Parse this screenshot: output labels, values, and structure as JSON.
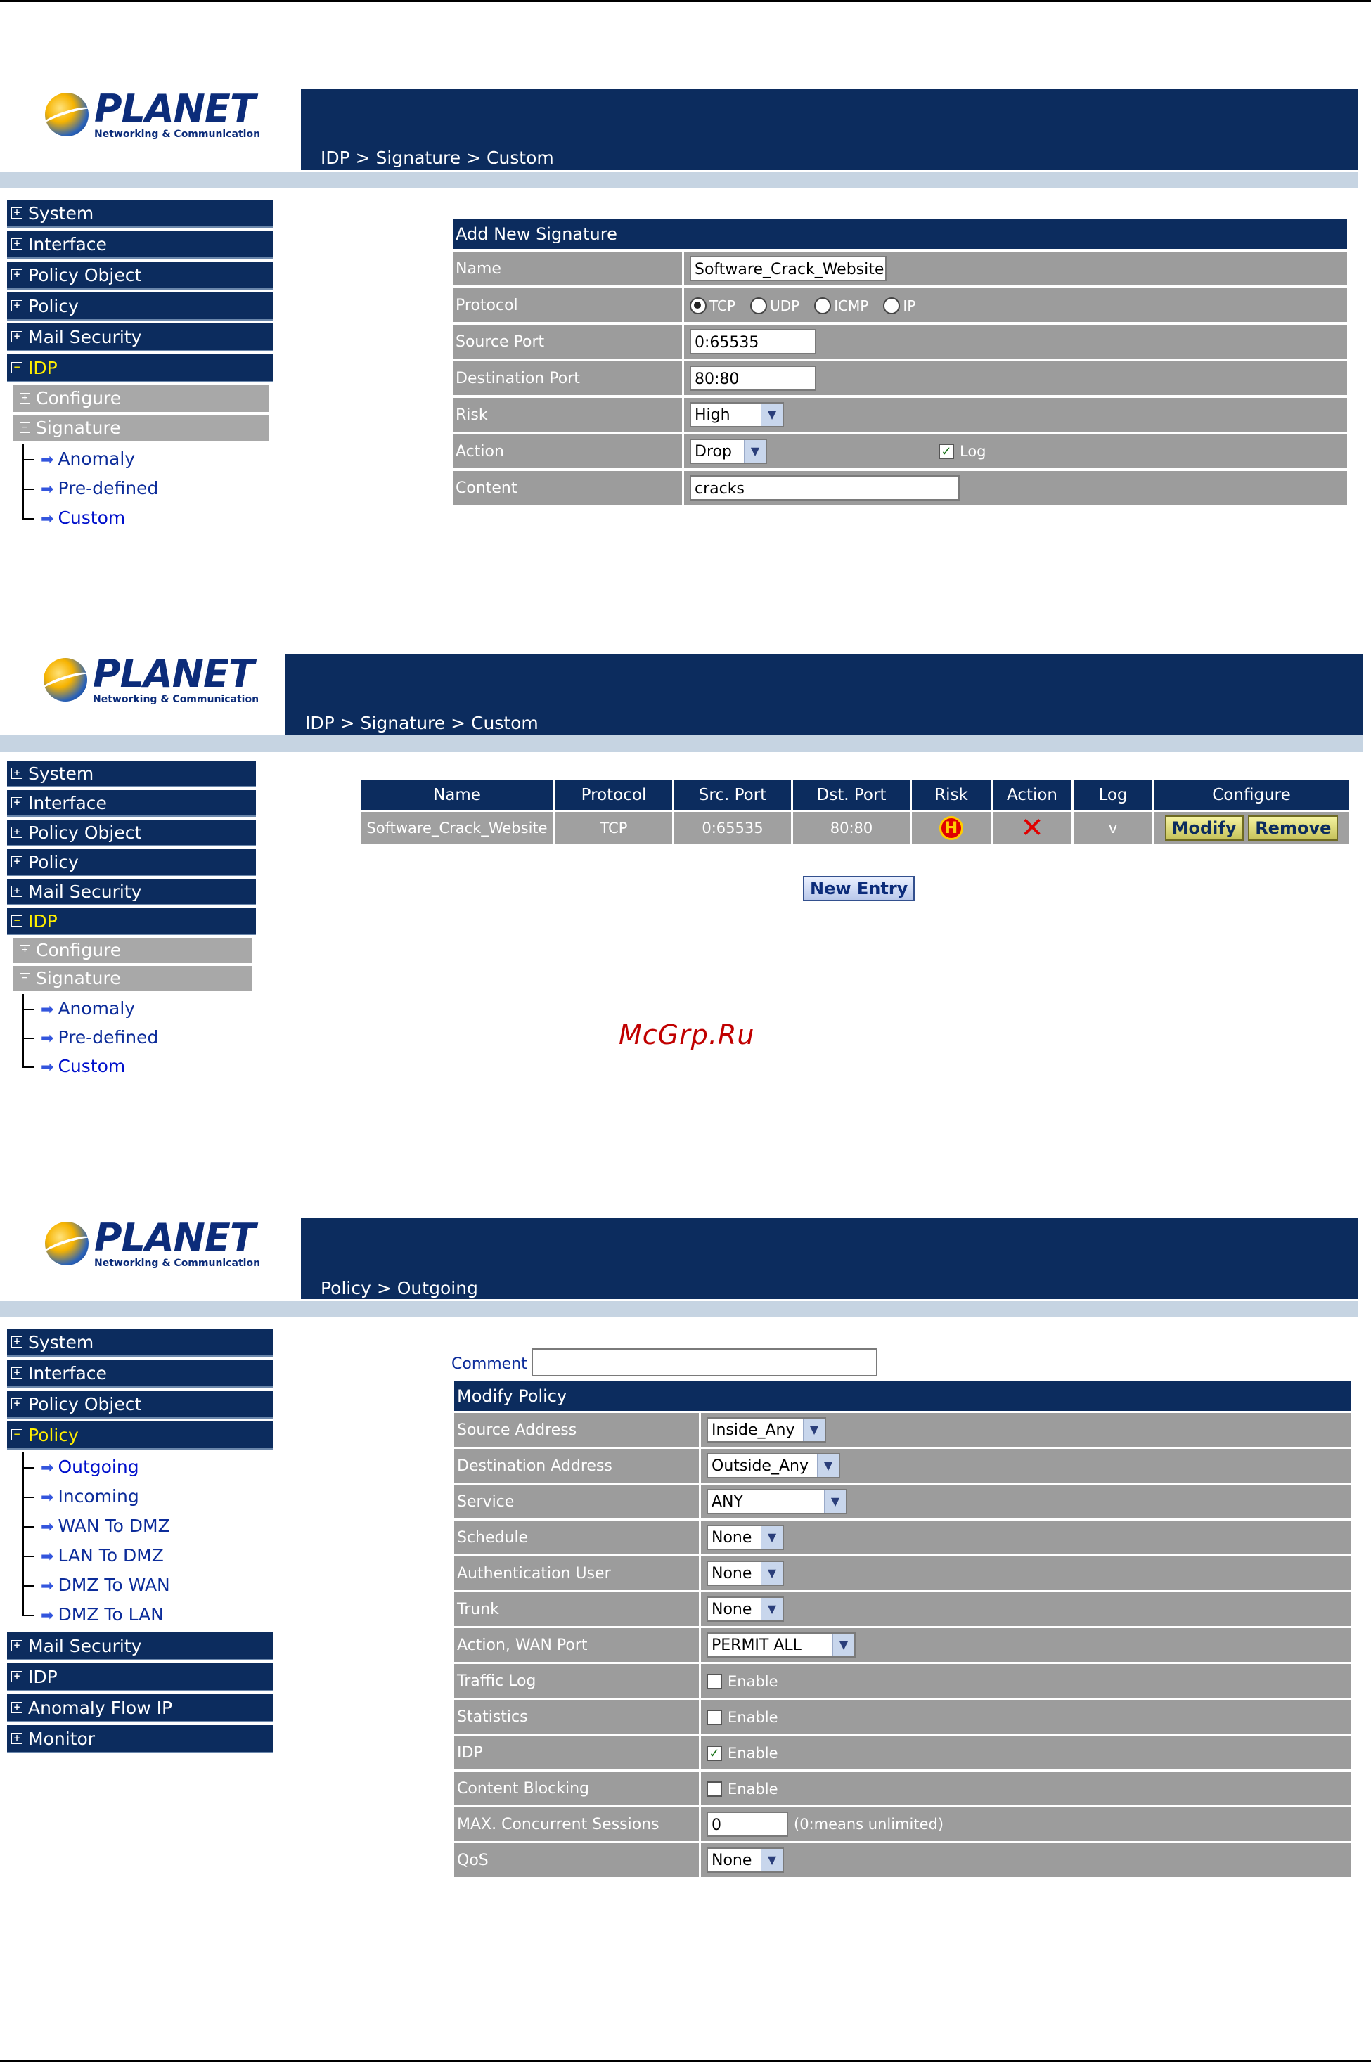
{
  "logo": {
    "brand": "PLANET",
    "tagline": "Networking & Communication"
  },
  "shot1": {
    "breadcrumb": "IDP > Signature > Custom",
    "menu": [
      "System",
      "Interface",
      "Policy Object",
      "Policy",
      "Mail Security",
      "IDP"
    ],
    "groups": [
      "Configure",
      "Signature"
    ],
    "tree": [
      "Anomaly",
      "Pre-defined",
      "Custom"
    ],
    "form": {
      "title": "Add New Signature",
      "name_label": "Name",
      "name_value": "Software_Crack_Website",
      "protocol_label": "Protocol",
      "protocols": [
        "TCP",
        "UDP",
        "ICMP",
        "IP"
      ],
      "src_label": "Source Port",
      "src_value": "0:65535",
      "dst_label": "Destination Port",
      "dst_value": "80:80",
      "risk_label": "Risk",
      "risk_value": "High",
      "action_label": "Action",
      "action_value": "Drop",
      "log_label": "Log",
      "content_label": "Content",
      "content_value": "cracks"
    }
  },
  "shot2": {
    "breadcrumb": "IDP > Signature > Custom",
    "menu": [
      "System",
      "Interface",
      "Policy Object",
      "Policy",
      "Mail Security",
      "IDP"
    ],
    "groups": [
      "Configure",
      "Signature"
    ],
    "tree": [
      "Anomaly",
      "Pre-defined",
      "Custom"
    ],
    "table": {
      "headers": [
        "Name",
        "Protocol",
        "Src. Port",
        "Dst. Port",
        "Risk",
        "Action",
        "Log",
        "Configure"
      ],
      "row": {
        "name": "Software_Crack_Website",
        "protocol": "TCP",
        "src": "0:65535",
        "dst": "80:80",
        "risk_icon": "H",
        "log": "v"
      },
      "modify": "Modify",
      "remove": "Remove"
    },
    "new_entry": "New Entry"
  },
  "watermark": "McGrp.Ru",
  "shot3": {
    "breadcrumb": "Policy > Outgoing",
    "menu_top": [
      "System",
      "Interface",
      "Policy Object",
      "Policy"
    ],
    "tree": [
      "Outgoing",
      "Incoming",
      "WAN To DMZ",
      "LAN To DMZ",
      "DMZ To WAN",
      "DMZ To LAN"
    ],
    "menu_bottom": [
      "Mail Security",
      "IDP",
      "Anomaly Flow IP",
      "Monitor"
    ],
    "comment_label": "Comment :",
    "form": {
      "title": "Modify Policy",
      "rows": [
        {
          "label": "Source Address",
          "value": "Inside_Any"
        },
        {
          "label": "Destination Address",
          "value": "Outside_Any"
        },
        {
          "label": "Service",
          "value": "ANY"
        },
        {
          "label": "Schedule",
          "value": "None"
        },
        {
          "label": "Authentication User",
          "value": "None"
        },
        {
          "label": "Trunk",
          "value": "None"
        },
        {
          "label": "Action, WAN Port",
          "value": "PERMIT ALL"
        },
        {
          "label": "Traffic Log",
          "value": "Enable"
        },
        {
          "label": "Statistics",
          "value": "Enable"
        },
        {
          "label": "IDP",
          "value": "Enable"
        },
        {
          "label": "Content Blocking",
          "value": "Enable"
        },
        {
          "label": "MAX. Concurrent Sessions",
          "value": "0",
          "note": "(0:means unlimited)"
        },
        {
          "label": "QoS",
          "value": "None"
        }
      ]
    }
  }
}
